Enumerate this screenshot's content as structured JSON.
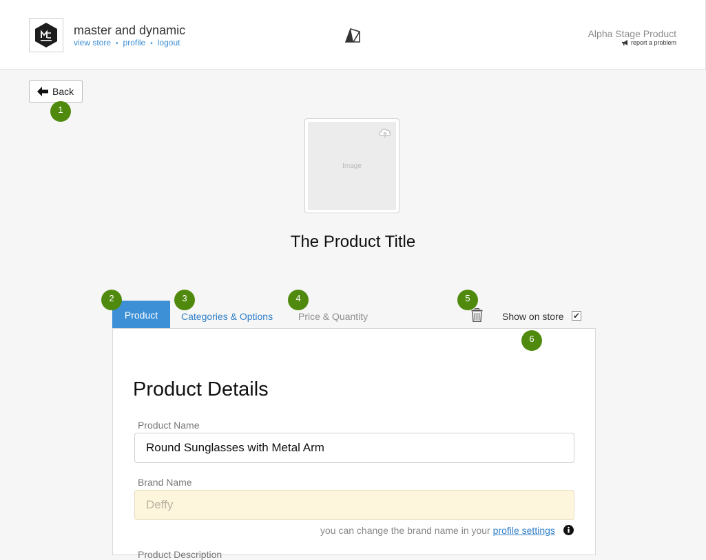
{
  "header": {
    "store_name": "master and dynamic",
    "links": {
      "view_store": "view store",
      "profile": "profile",
      "logout": "logout",
      "separator": "•"
    },
    "stage": "Alpha Stage Product",
    "report": "report a problem"
  },
  "back_button": {
    "label": "Back"
  },
  "image": {
    "placeholder": "Image"
  },
  "product_title": "The Product Title",
  "tabs": {
    "product": "Product",
    "categories": "Categories & Options",
    "price": "Price & Quantity"
  },
  "show_on_store": {
    "label": "Show on store",
    "checked": true,
    "check_mark": "✔"
  },
  "panel": {
    "heading": "Product Details",
    "product_name": {
      "label": "Product Name",
      "value": "Round Sunglasses with Metal Arm"
    },
    "brand_name": {
      "label": "Brand Name",
      "value": "Deffy"
    },
    "help_text": "you can change the brand name in your ",
    "help_link": "profile settings",
    "next_label": "Product Description"
  },
  "markers": [
    "1",
    "2",
    "3",
    "4",
    "5",
    "6"
  ],
  "colors": {
    "accent": "#3d8fd6",
    "marker": "#4f8a0f",
    "link": "#2f7fc8"
  }
}
